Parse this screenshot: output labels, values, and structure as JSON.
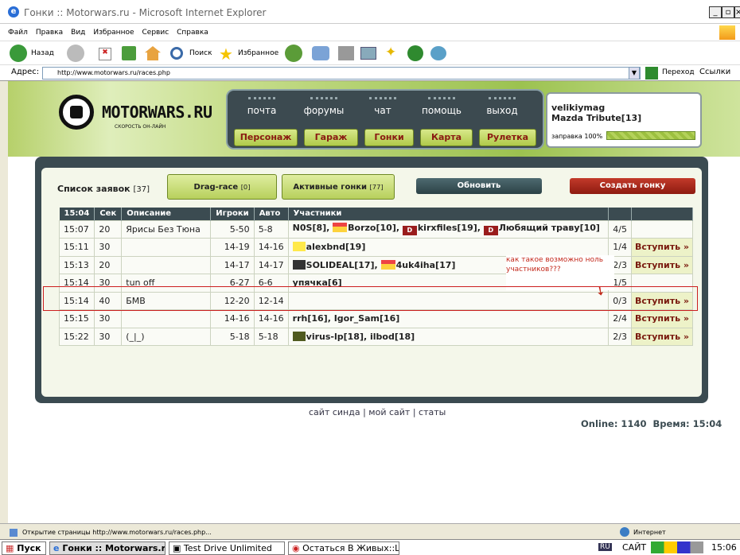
{
  "window": {
    "title": "Гонки :: Motorwars.ru - Microsoft Internet Explorer"
  },
  "menu": [
    "Файл",
    "Правка",
    "Вид",
    "Избранное",
    "Сервис",
    "Справка"
  ],
  "toolbar": {
    "back": "Назад",
    "search": "Поиск",
    "favorites": "Избранное"
  },
  "address": {
    "label": "Адрес:",
    "url": "http://www.motorwars.ru/races.php",
    "go": "Переход",
    "links": "Ссылки"
  },
  "site": {
    "logo": "MOTORWARS.RU",
    "slogan": "СКОРОСТЬ ОН-ЛАЙН"
  },
  "nav_top": [
    "почта",
    "форумы",
    "чат",
    "помощь",
    "выход"
  ],
  "nav_bottom": [
    "Персонаж",
    "Гараж",
    "Гонки",
    "Карта",
    "Рулетка"
  ],
  "user": {
    "name": "velikiymag",
    "car": "Mazda Tribute[13]",
    "fuel_label": "заправка 100%",
    "fuel": 1.0
  },
  "panel": {
    "title": "Список заявок",
    "title_count": "[37]",
    "tab_drag": "Drag-race",
    "tab_drag_count": "[0]",
    "tab_active": "Активные гонки",
    "tab_active_count": "[77]",
    "refresh": "Обновить",
    "create": "Создать гонку"
  },
  "table": {
    "headers": [
      "15:04",
      "Сек",
      "Описание",
      "Игроки",
      "Авто",
      "Участники",
      "",
      ""
    ],
    "rows": [
      {
        "time": "15:07",
        "sec": "20",
        "desc": "Ярисы Без Тюна",
        "players": "5-50",
        "auto": "5-8",
        "count": "4/5",
        "join": ""
      },
      {
        "time": "15:11",
        "sec": "30",
        "desc": "",
        "players": "14-19",
        "auto": "14-16",
        "count": "1/4",
        "join": "Вступить »"
      },
      {
        "time": "15:13",
        "sec": "20",
        "desc": "",
        "players": "14-17",
        "auto": "14-17",
        "count": "2/3",
        "join": "Вступить »"
      },
      {
        "time": "15:14",
        "sec": "30",
        "desc": "tun off",
        "players": "6-27",
        "auto": "6-6",
        "count": "1/5",
        "join": ""
      },
      {
        "time": "15:14",
        "sec": "40",
        "desc": "БМВ",
        "players": "12-20",
        "auto": "12-14",
        "count": "0/3",
        "join": "Вступить »"
      },
      {
        "time": "15:15",
        "sec": "30",
        "desc": "",
        "players": "14-16",
        "auto": "14-16",
        "count": "2/4",
        "join": "Вступить »"
      },
      {
        "time": "15:22",
        "sec": "30",
        "desc": "(_|_)",
        "players": "5-18",
        "auto": "5-18",
        "count": "2/3",
        "join": "Вступить »"
      }
    ],
    "participants": {
      "r0": [
        "N0S[8], ",
        "Borzo[10], ",
        "kirxfiles[19], ",
        "Любящий траву[10]"
      ],
      "r1": [
        "alexbnd[19]"
      ],
      "r2": [
        "SOLIDEAL[17], ",
        "4uk4iha[17]"
      ],
      "r3": [
        "упячка[6]"
      ],
      "r5": [
        "rrh[16], Igor_Sam[16]"
      ],
      "r6": [
        "virus-lp[18], ilbod[18]"
      ]
    },
    "d_badge": "D"
  },
  "annotation": "как такое возможно ноль участников???",
  "footer": {
    "links": [
      "сайт синда",
      "мой сайт",
      "статы"
    ],
    "sep": "|",
    "online": "Online: 1140",
    "time": "Время: 15:04"
  },
  "statusbar": {
    "text": "Открытие страницы http://www.motorwars.ru/races.php...",
    "zone": "Интернет"
  },
  "taskbar": {
    "start": "Пуск",
    "tasks": [
      "Гонки :: Motorwars.ru...",
      "Test Drive Unlimited",
      "Остаться В Живых::L..."
    ],
    "lang": "RU",
    "site": "САЙТ",
    "clock": "15:06"
  },
  "colors": {
    "panel": "#3b4b51",
    "accent_green": "#b0ca4a",
    "join": "#7a1b0f",
    "create": "#8e1b10"
  }
}
